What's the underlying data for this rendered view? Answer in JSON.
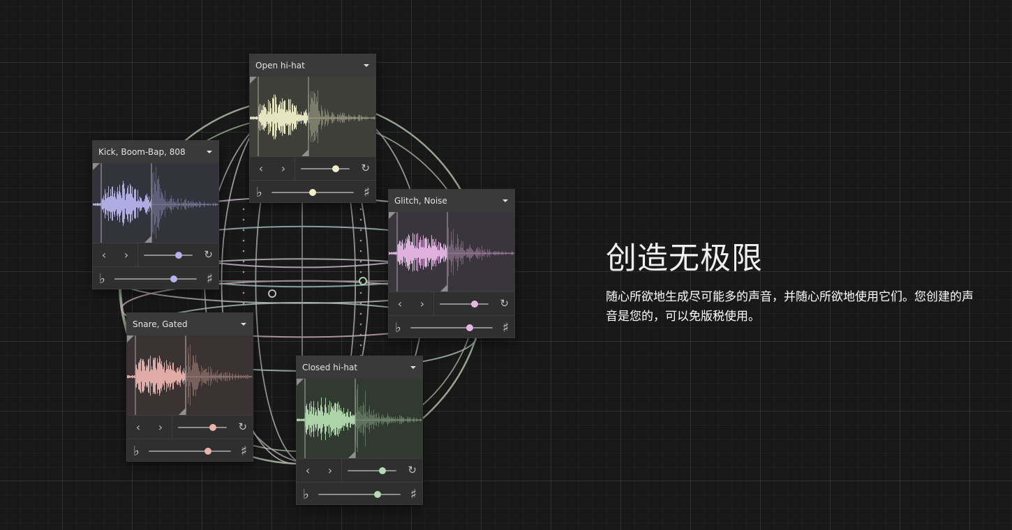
{
  "heading": "创造无极限",
  "description": "随心所欲地生成尽可能多的声音，并随心所欲地使用它们。您创建的声音是您的，可以免版税使用。",
  "icons": {
    "prev": "chevron-left-icon",
    "next": "chevron-right-icon",
    "regenerate": "refresh-icon",
    "flat": "flat-icon",
    "sharp": "sharp-icon",
    "dropdown": "caret-down-icon"
  },
  "glyphs": {
    "prev": "‹",
    "next": "›",
    "reload": "↻",
    "flat": "♭",
    "sharp": "♯"
  },
  "panels": [
    {
      "title": "Open hi-hat",
      "color": "#efeec9",
      "bg": "#3e3f39",
      "variation": 0.72,
      "pitch": 0.5,
      "seed": 3
    },
    {
      "title": "Kick, Boom-Bap, 808",
      "color": "#b6b2ec",
      "bg": "#33333c",
      "variation": 0.72,
      "pitch": 0.72,
      "seed": 7
    },
    {
      "title": "Glitch, Noise",
      "color": "#e6b7e6",
      "bg": "#3a343c",
      "variation": 0.72,
      "pitch": 0.72,
      "seed": 11
    },
    {
      "title": "Snare, Gated",
      "color": "#ebb3ad",
      "bg": "#3b3333",
      "variation": 0.72,
      "pitch": 0.72,
      "seed": 5
    },
    {
      "title": "Closed hi-hat",
      "color": "#b4dcb2",
      "bg": "#313a31",
      "variation": 0.72,
      "pitch": 0.72,
      "seed": 9
    }
  ]
}
